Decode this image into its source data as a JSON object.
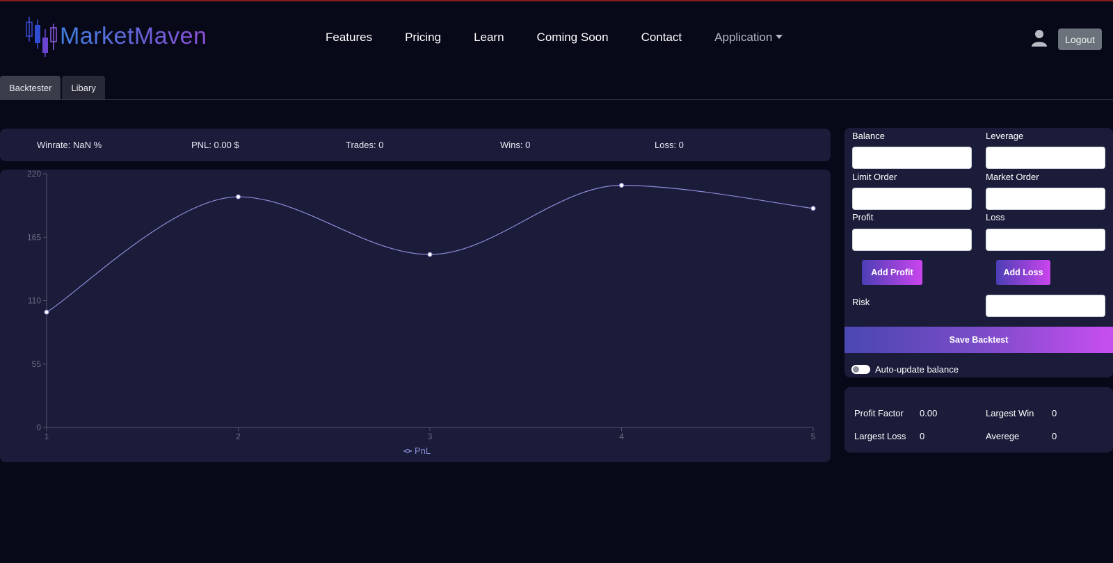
{
  "brand": {
    "name": "MarketMaven"
  },
  "nav": {
    "items": [
      {
        "label": "Features"
      },
      {
        "label": "Pricing"
      },
      {
        "label": "Learn"
      },
      {
        "label": "Coming Soon"
      },
      {
        "label": "Contact"
      }
    ],
    "dropdown_label": "Application",
    "logout_label": "Logout"
  },
  "tabs": [
    {
      "label": "Backtester",
      "active": true
    },
    {
      "label": "Libary",
      "active": false
    }
  ],
  "stats": {
    "winrate": "Winrate: NaN %",
    "pnl": "PNL: 0.00 $",
    "trades": "Trades: 0",
    "wins": "Wins: 0",
    "loss": "Loss: 0"
  },
  "chart_data": {
    "type": "line",
    "x": [
      1,
      2,
      3,
      4,
      5
    ],
    "series": [
      {
        "name": "PnL",
        "values": [
          100,
          200,
          150,
          210,
          190
        ]
      }
    ],
    "ylim": [
      0,
      220
    ],
    "yticks": [
      0,
      55,
      110,
      165,
      220
    ],
    "xticks": [
      1,
      2,
      3,
      4,
      5
    ],
    "legend": "bottom",
    "line_color": "#8f8bd8",
    "grid": false
  },
  "form": {
    "balance_label": "Balance",
    "leverage_label": "Leverage",
    "limit_order_label": "Limit Order",
    "market_order_label": "Market Order",
    "profit_label": "Profit",
    "loss_label": "Loss",
    "risk_label": "Risk",
    "balance_value": "",
    "leverage_value": "",
    "limit_order_value": "",
    "market_order_value": "",
    "profit_value": "",
    "loss_value": "",
    "risk_value": "",
    "add_profit_label": "Add Profit",
    "add_loss_label": "Add Loss",
    "save_label": "Save Backtest",
    "auto_update_label": "Auto-update balance",
    "auto_update_on": false
  },
  "summary": {
    "profit_factor_label": "Profit Factor",
    "profit_factor_value": "0.00",
    "largest_win_label": "Largest Win",
    "largest_win_value": "0",
    "largest_loss_label": "Largest Loss",
    "largest_loss_value": "0",
    "average_label": "Averege",
    "average_value": "0"
  },
  "colors": {
    "background": "#070818",
    "panel": "#1b1c3a",
    "accent_start": "#4b3fb5",
    "accent_end": "#cb45ee"
  }
}
